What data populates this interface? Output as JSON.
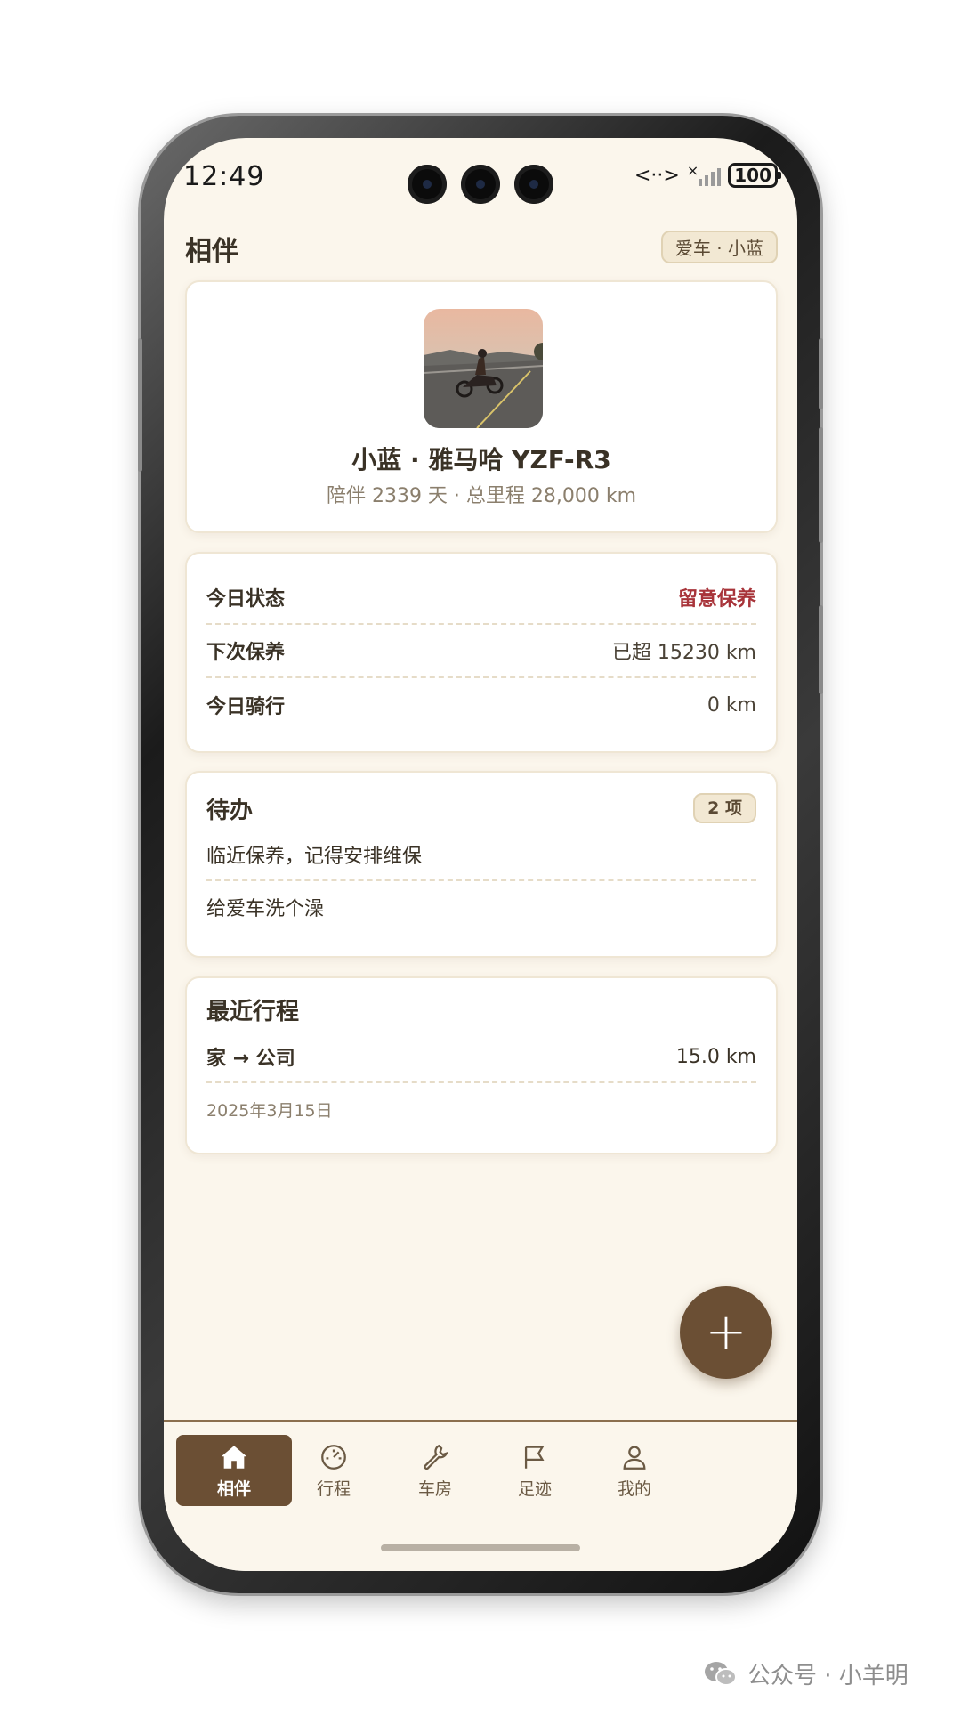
{
  "status_bar": {
    "time": "12:49",
    "battery": "100",
    "network_glyph": "<··>",
    "signal_prefix": "×"
  },
  "header": {
    "title": "相伴",
    "car_chip": "爱车 · 小蓝"
  },
  "profile": {
    "name": "小蓝 · 雅马哈 YZF-R3",
    "subtitle": "陪伴 2339 天 · 总里程 28,000 km"
  },
  "status": {
    "rows": [
      {
        "label": "今日状态",
        "value": "留意保养"
      },
      {
        "label": "下次保养",
        "value": "已超 15230 km"
      },
      {
        "label": "今日骑行",
        "value": "0 km"
      }
    ]
  },
  "todo": {
    "title": "待办",
    "count": "2 项",
    "items": [
      "临近保养，记得安排维保",
      "给爱车洗个澡"
    ]
  },
  "trip": {
    "title": "最近行程",
    "route": "家 → 公司",
    "distance": "15.0 km",
    "date": "2025年3月15日"
  },
  "fab": {
    "symbol": "+"
  },
  "nav": {
    "items": [
      {
        "label": "相伴",
        "icon": "home-icon",
        "active": true
      },
      {
        "label": "行程",
        "icon": "speedometer-icon",
        "active": false
      },
      {
        "label": "车房",
        "icon": "wrench-icon",
        "active": false
      },
      {
        "label": "足迹",
        "icon": "flag-icon",
        "active": false
      },
      {
        "label": "我的",
        "icon": "user-icon",
        "active": false
      }
    ]
  },
  "watermark": {
    "text": "公众号 · 小羊明"
  },
  "colors": {
    "accent": "#6b4f34",
    "alert": "#a8343a",
    "background": "#fbf6ec"
  }
}
